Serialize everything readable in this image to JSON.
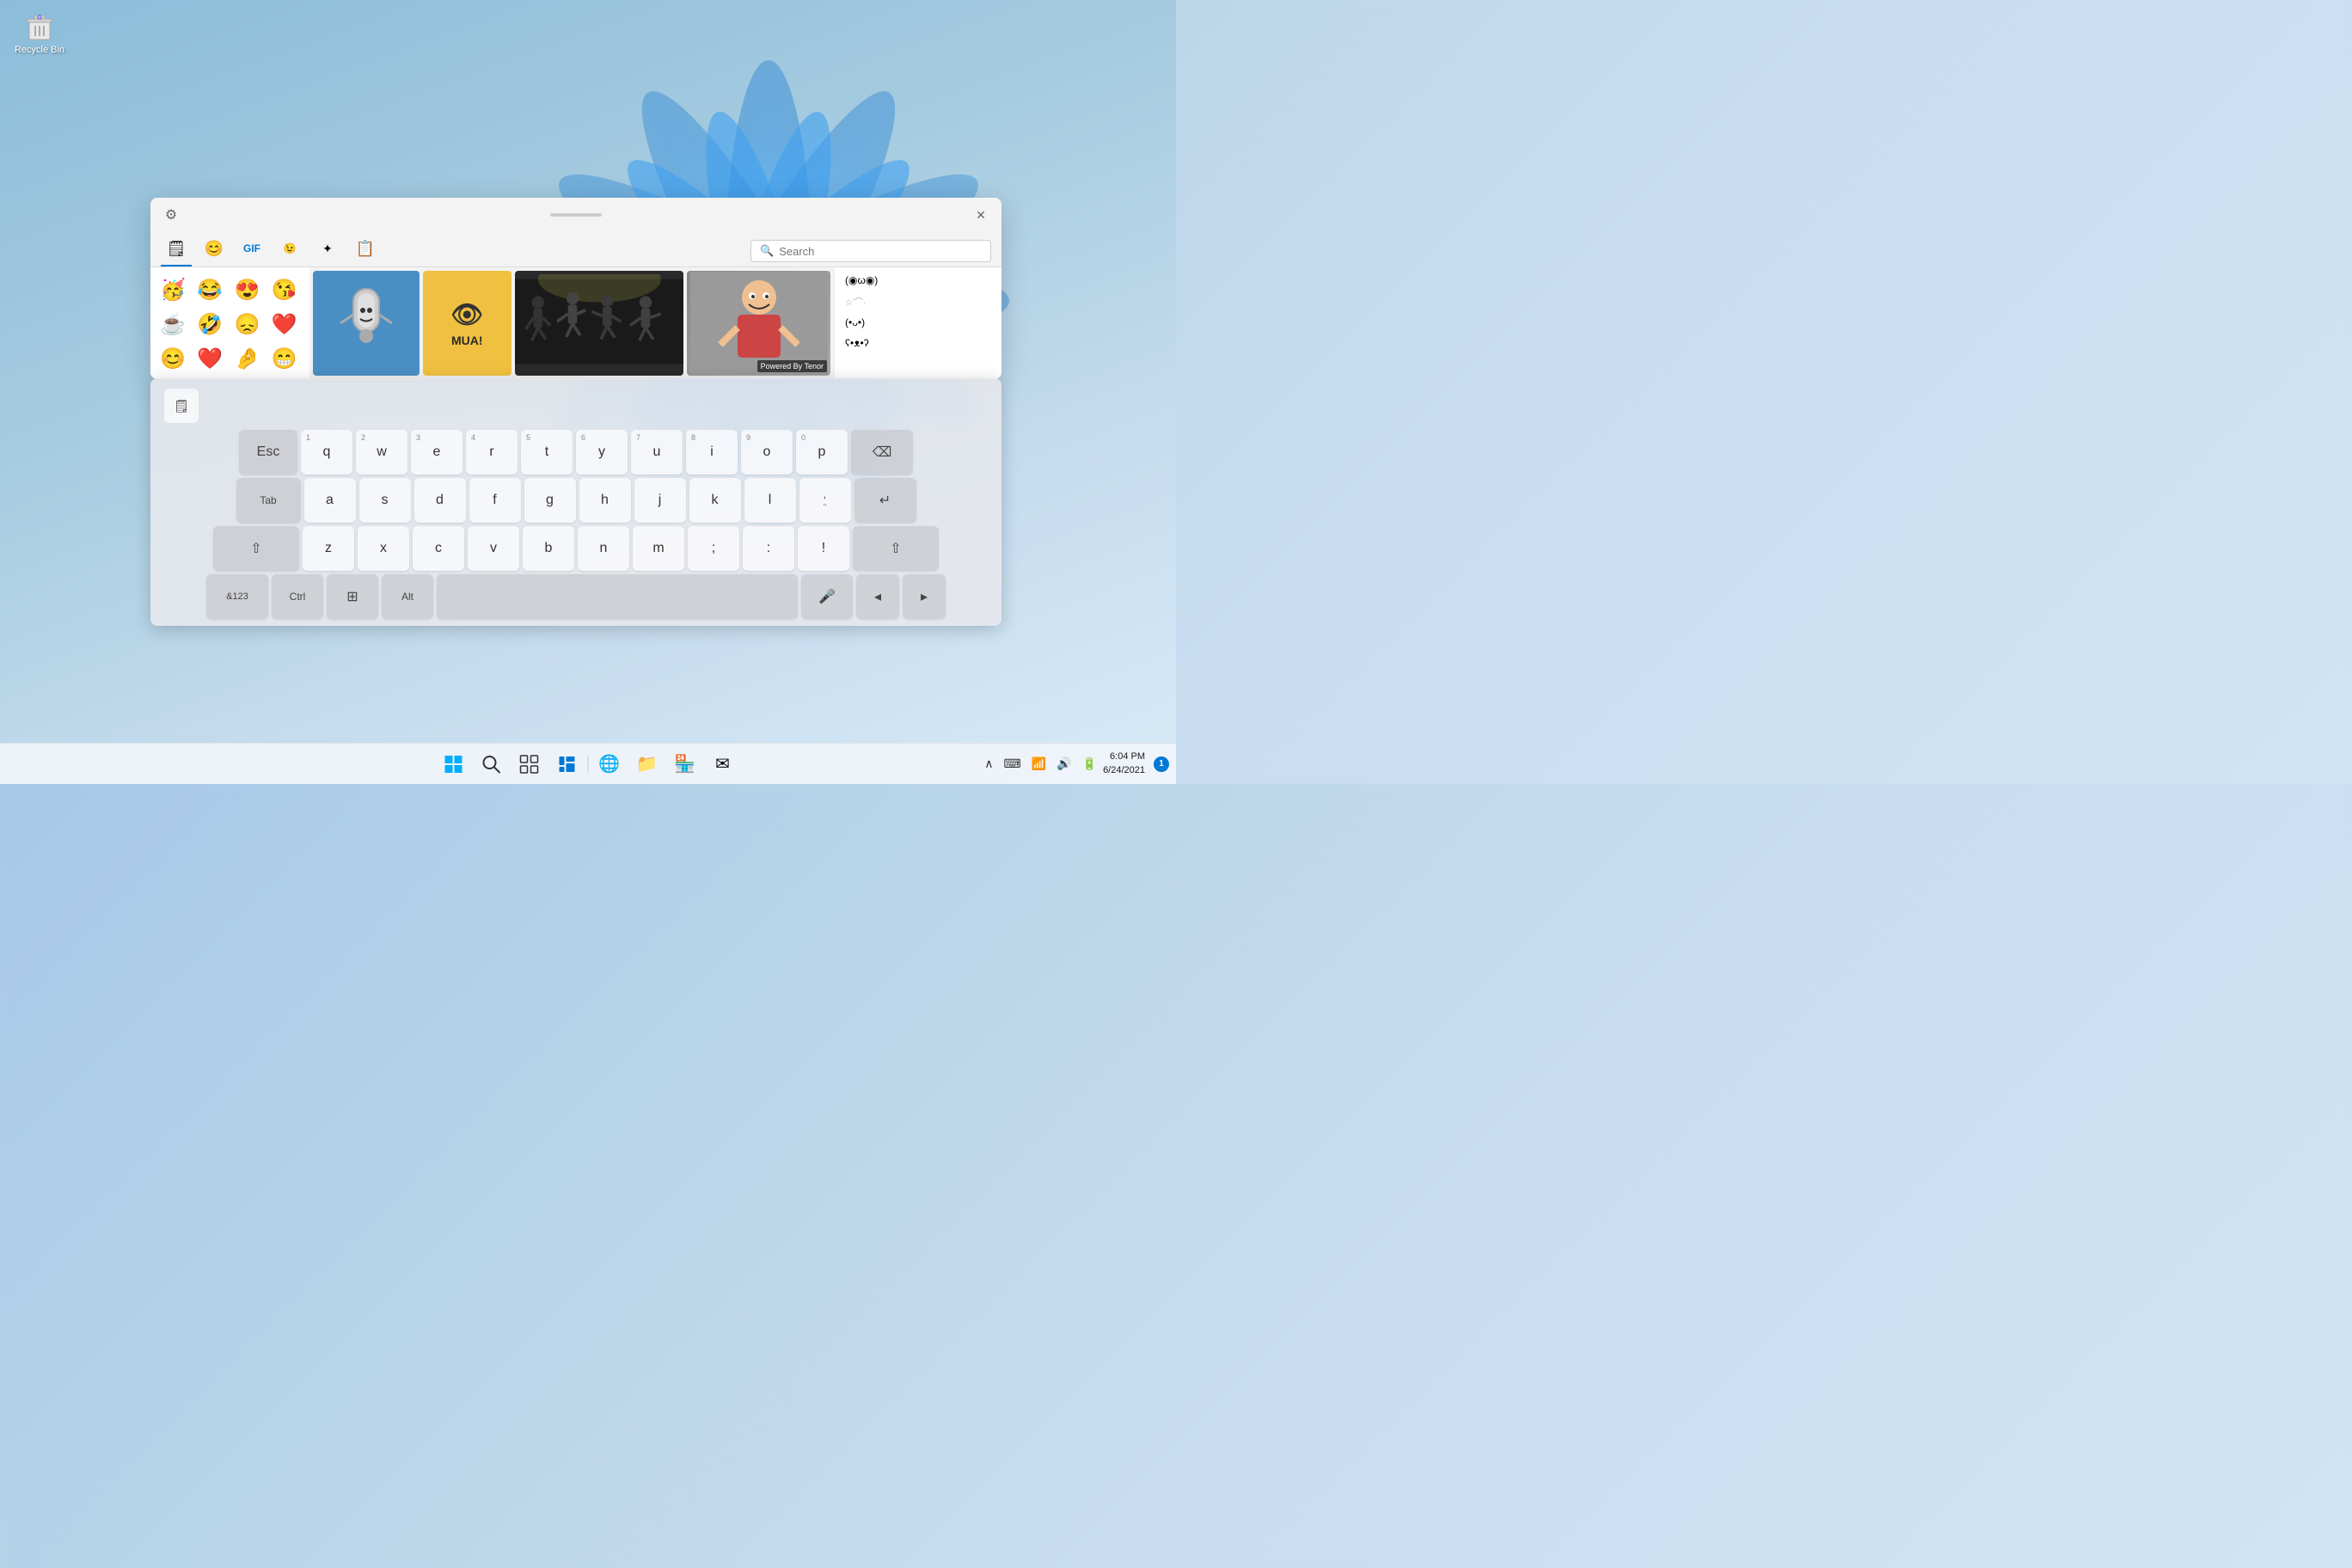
{
  "desktop": {
    "recycle_bin_label": "Recycle Bin"
  },
  "emoji_panel": {
    "settings_icon": "⚙",
    "close_icon": "✕",
    "drag_handle": "",
    "tabs": [
      {
        "id": "clipboard",
        "icon": "🗒",
        "active": true
      },
      {
        "id": "emoji",
        "icon": "😊"
      },
      {
        "id": "gif",
        "icon": "GIF"
      },
      {
        "id": "kaomoji",
        "icon": ";-)"
      },
      {
        "id": "symbols",
        "icon": "✦"
      },
      {
        "id": "clipboard2",
        "icon": "📋"
      }
    ],
    "search_placeholder": "Search",
    "emojis": [
      "🥳",
      "😂",
      "😍",
      "😘",
      "☕",
      "🤣",
      "😞",
      "❤️",
      "😊",
      "❤️",
      "🤌",
      "😁"
    ],
    "gifs": [
      {
        "id": "paperclip",
        "label": ""
      },
      {
        "id": "minions",
        "label": "MUA!"
      },
      {
        "id": "dancing",
        "label": ""
      },
      {
        "id": "person",
        "label": ""
      }
    ],
    "powered_by_tenor": "Powered By Tenor",
    "kaomojis": [
      "(◉ω◉)",
      "☆ʼ⌒·",
      "(•ᴗ•)",
      "ʕ•ᴥ•ʔ"
    ]
  },
  "keyboard": {
    "toolbar_icon": "🗒",
    "rows": [
      {
        "keys": [
          {
            "label": "Esc",
            "type": "special esc"
          },
          {
            "num": "1",
            "label": "q"
          },
          {
            "num": "2",
            "label": "w"
          },
          {
            "num": "3",
            "label": "e"
          },
          {
            "num": "4",
            "label": "r"
          },
          {
            "num": "5",
            "label": "t"
          },
          {
            "num": "6",
            "label": "y"
          },
          {
            "num": "7",
            "label": "u"
          },
          {
            "num": "8",
            "label": "i"
          },
          {
            "num": "9",
            "label": "o"
          },
          {
            "num": "0",
            "label": "p"
          },
          {
            "label": "⌫",
            "type": "special backspace"
          }
        ]
      },
      {
        "keys": [
          {
            "label": "Tab",
            "type": "special tab"
          },
          {
            "label": "a"
          },
          {
            "label": "s"
          },
          {
            "label": "d"
          },
          {
            "label": "f"
          },
          {
            "label": "g"
          },
          {
            "label": "h"
          },
          {
            "label": "j"
          },
          {
            "label": "k"
          },
          {
            "label": "l"
          },
          {
            "label": ",",
            "sub": "\""
          },
          {
            "label": "↵",
            "type": "special enter"
          }
        ]
      },
      {
        "keys": [
          {
            "label": "⇧",
            "type": "special shift"
          },
          {
            "label": "z"
          },
          {
            "label": "x"
          },
          {
            "label": "c"
          },
          {
            "label": "v"
          },
          {
            "label": "b"
          },
          {
            "label": "n"
          },
          {
            "label": "m"
          },
          {
            "label": ";"
          },
          {
            "label": ":"
          },
          {
            "label": "!"
          },
          {
            "label": "⇧",
            "type": "special shift-r"
          }
        ]
      },
      {
        "keys": [
          {
            "label": "&123",
            "type": "special sym"
          },
          {
            "label": "Ctrl",
            "type": "special ctrl"
          },
          {
            "label": "⊞",
            "type": "special win"
          },
          {
            "label": "Alt",
            "type": "special alt"
          },
          {
            "label": "",
            "type": "special space"
          },
          {
            "label": "🎤",
            "type": "special mic"
          },
          {
            "label": "◂",
            "type": "special arrow"
          },
          {
            "label": "▸",
            "type": "special arrow"
          }
        ]
      }
    ]
  },
  "taskbar": {
    "start_icon": "⊞",
    "search_icon": "🔍",
    "taskview_icon": "❑",
    "widgets_icon": "⊟",
    "edge_icon": "e",
    "files_icon": "📁",
    "store_icon": "🏪",
    "mail_icon": "✉",
    "clock_time": "6:04 PM",
    "clock_date": "6/24/2021",
    "notification_count": "1",
    "tray_icons": [
      "∧",
      "⌨",
      "📶",
      "🔊",
      "🔋"
    ]
  }
}
